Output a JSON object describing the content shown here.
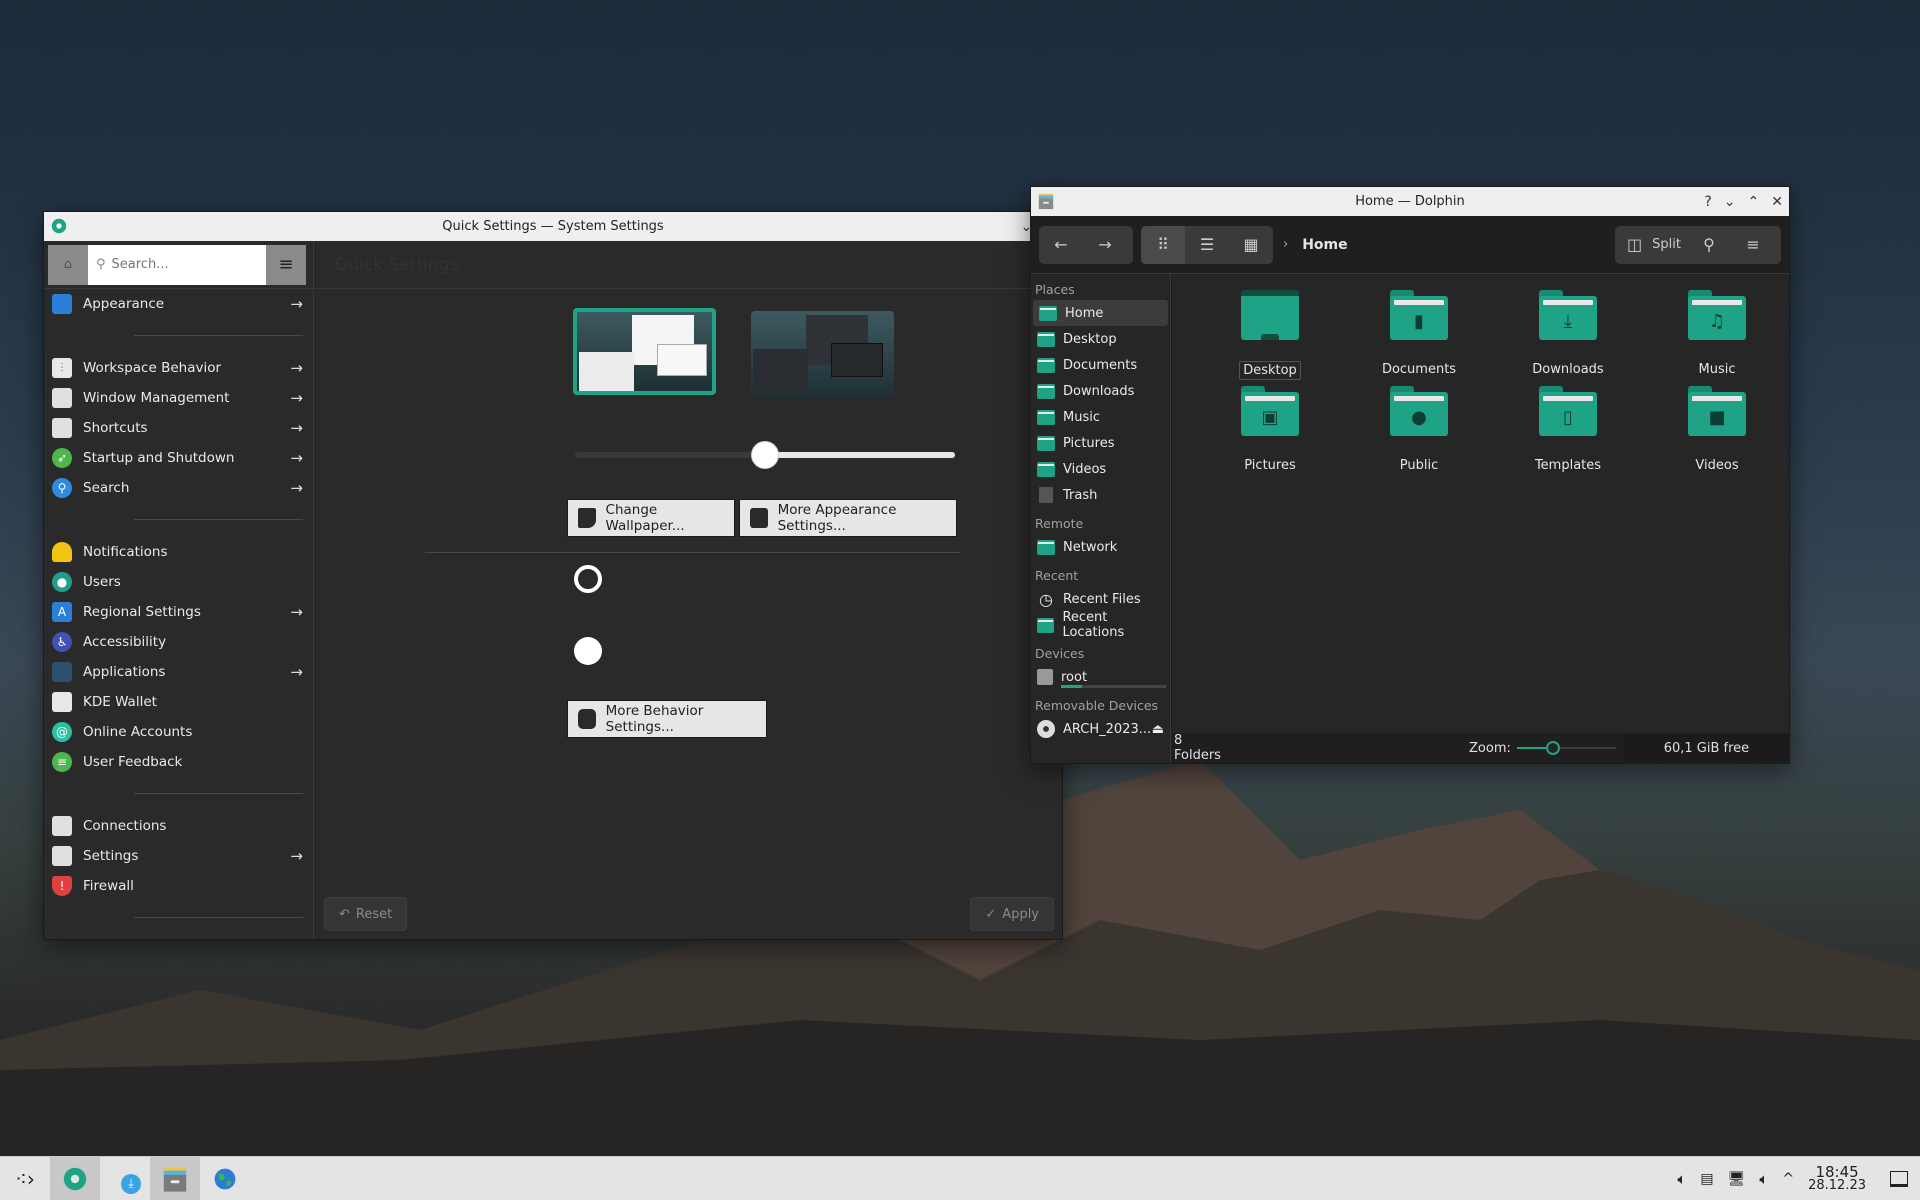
{
  "system_settings": {
    "title": "Quick Settings — System Settings",
    "search_placeholder": "Search...",
    "page_title": "Quick Settings",
    "sidebar": {
      "items": [
        {
          "label": "Appearance",
          "icon": "appearance-icon",
          "has_children": true
        },
        {
          "label": "Workspace Behavior",
          "icon": "workspace-behavior-icon",
          "has_children": true
        },
        {
          "label": "Window Management",
          "icon": "window-management-icon",
          "has_children": true
        },
        {
          "label": "Shortcuts",
          "icon": "shortcuts-icon",
          "has_children": true
        },
        {
          "label": "Startup and Shutdown",
          "icon": "rocket-icon",
          "has_children": true
        },
        {
          "label": "Search",
          "icon": "search-icon",
          "has_children": true
        },
        {
          "label": "Notifications",
          "icon": "bell-icon",
          "has_children": false
        },
        {
          "label": "Users",
          "icon": "user-icon",
          "has_children": false
        },
        {
          "label": "Regional Settings",
          "icon": "language-icon",
          "has_children": true
        },
        {
          "label": "Accessibility",
          "icon": "accessibility-icon",
          "has_children": false
        },
        {
          "label": "Applications",
          "icon": "applications-icon",
          "has_children": true
        },
        {
          "label": "KDE Wallet",
          "icon": "wallet-icon",
          "has_children": false
        },
        {
          "label": "Online Accounts",
          "icon": "at-icon",
          "has_children": false
        },
        {
          "label": "User Feedback",
          "icon": "feedback-icon",
          "has_children": false
        },
        {
          "label": "Connections",
          "icon": "connections-icon",
          "has_children": false
        },
        {
          "label": "Settings",
          "icon": "network-settings-icon",
          "has_children": true
        },
        {
          "label": "Firewall",
          "icon": "firewall-icon",
          "has_children": false
        }
      ]
    },
    "content": {
      "animation_speed_fraction": 0.5,
      "change_wallpaper_label": "Change Wallpaper...",
      "more_appearance_label": "More Appearance Settings...",
      "more_behavior_label": "More Behavior Settings...",
      "reset_label": "Reset",
      "apply_label": "Apply"
    }
  },
  "dolphin": {
    "title": "Home — Dolphin",
    "breadcrumb": "Home",
    "split_label": "Split",
    "places": {
      "sections": [
        {
          "heading": "Places",
          "items": [
            {
              "label": "Home",
              "selected": true
            },
            {
              "label": "Desktop"
            },
            {
              "label": "Documents"
            },
            {
              "label": "Downloads"
            },
            {
              "label": "Music"
            },
            {
              "label": "Pictures"
            },
            {
              "label": "Videos"
            },
            {
              "label": "Trash"
            }
          ]
        },
        {
          "heading": "Remote",
          "items": [
            {
              "label": "Network"
            }
          ]
        },
        {
          "heading": "Recent",
          "items": [
            {
              "label": "Recent Files"
            },
            {
              "label": "Recent Locations"
            }
          ]
        },
        {
          "heading": "Devices",
          "items": [
            {
              "label": "root"
            }
          ]
        },
        {
          "heading": "Removable Devices",
          "items": [
            {
              "label": "ARCH_2023..."
            }
          ]
        }
      ]
    },
    "files": [
      {
        "name": "Desktop",
        "glyph": ""
      },
      {
        "name": "Documents",
        "glyph": "▮"
      },
      {
        "name": "Downloads",
        "glyph": "⤓"
      },
      {
        "name": "Music",
        "glyph": "♫"
      },
      {
        "name": "Pictures",
        "glyph": "▣"
      },
      {
        "name": "Public",
        "glyph": "●"
      },
      {
        "name": "Templates",
        "glyph": "▯"
      },
      {
        "name": "Videos",
        "glyph": "■"
      }
    ],
    "status": {
      "count": "8 Folders",
      "zoom_label": "Zoom:",
      "zoom_fraction": 0.3,
      "free_space": "60,1 GiB free"
    }
  },
  "taskbar": {
    "time": "18:45",
    "date": "28.12.23"
  },
  "colors": {
    "accent": "#1fa386",
    "dark_bg": "#2a2a2a"
  }
}
